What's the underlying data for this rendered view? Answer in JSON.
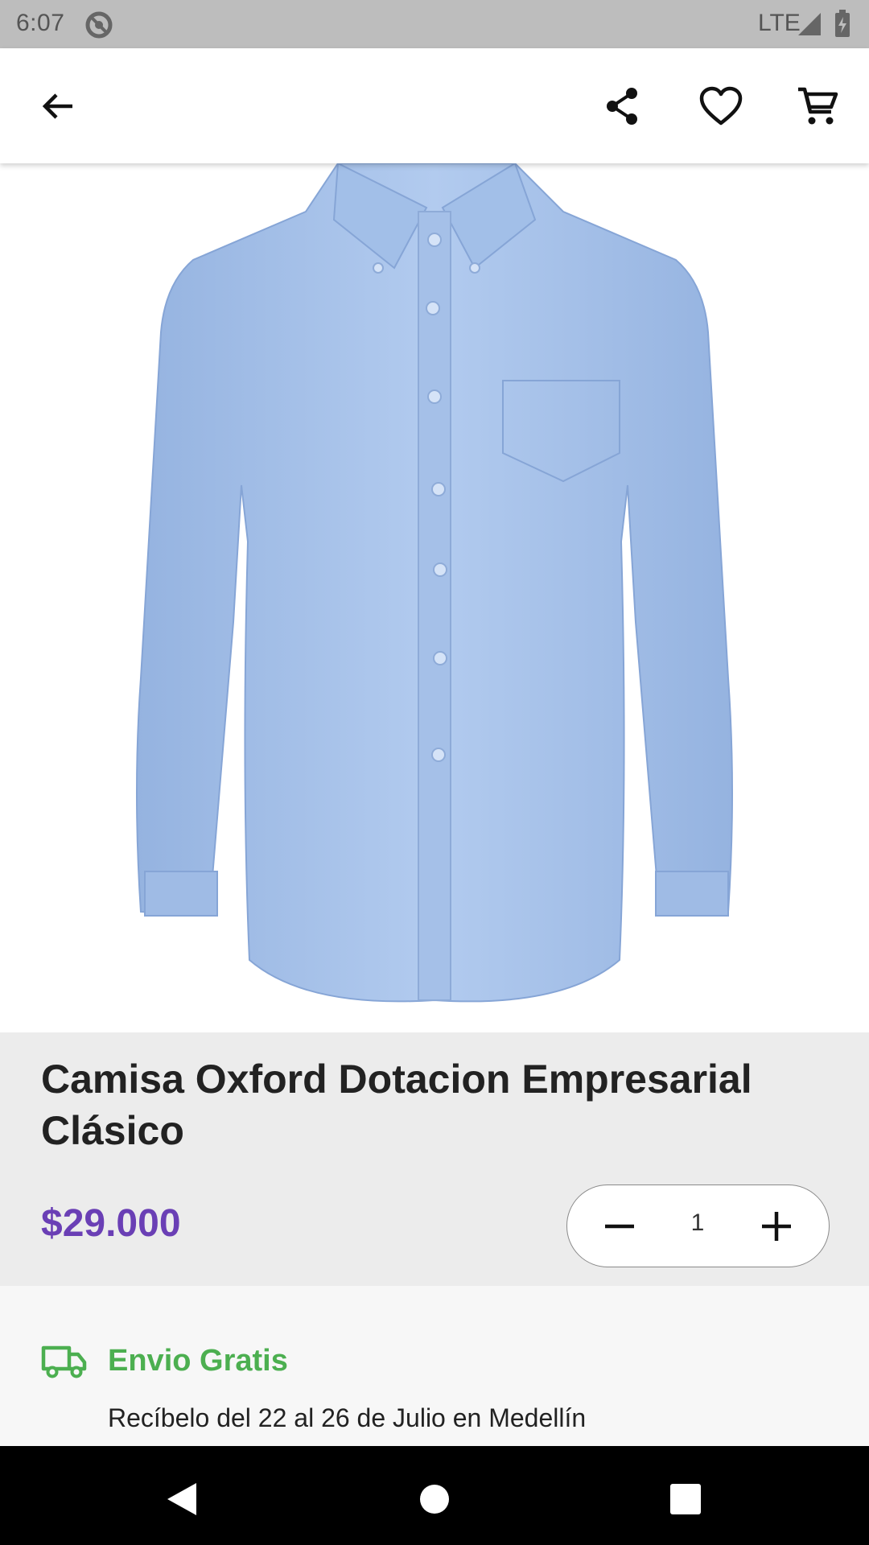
{
  "status_bar": {
    "time": "6:07",
    "network": "LTE"
  },
  "product": {
    "title": "Camisa Oxford Dotacion Empresarial Clásico",
    "price": "$29.000",
    "quantity": "1"
  },
  "shipping": {
    "title": "Envio Gratis",
    "text": "Recíbelo del 22 al 26 de Julio en Medellín"
  },
  "colors": {
    "price": "#6a3fb5",
    "shipping": "#4caf50",
    "shirt": "#a9c3ea"
  }
}
